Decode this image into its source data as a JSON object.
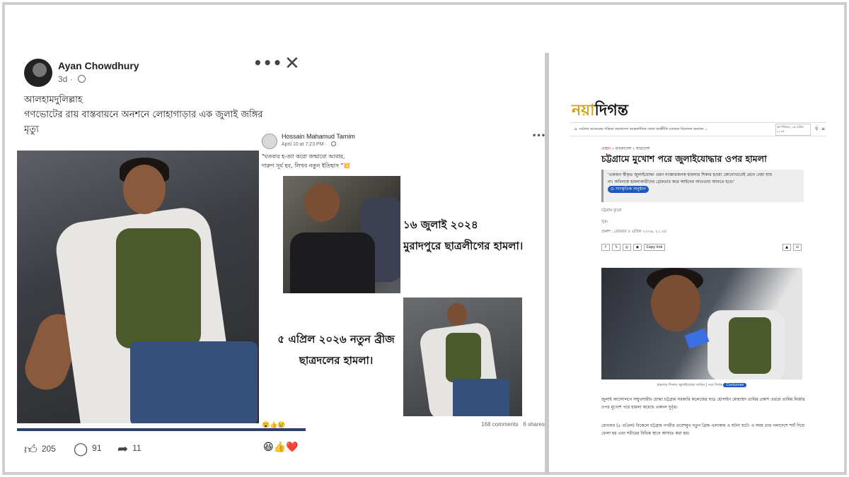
{
  "fb_post": {
    "author": "Ayan Chowdhury",
    "time": "3d",
    "text_line1": "আলহামদুলিল্লাহ",
    "text_line2": "গণভোটের রায় বাস্তবায়নে অনশনে লোহাগাড়ার এক জুলাই জঙ্গির",
    "text_line3": "মৃত্যু",
    "likes": "205",
    "comments": "91",
    "shares": "11"
  },
  "shared_post": {
    "author": "Hossain Mahamud Tamim",
    "time": "April 10 at 7:23 PM",
    "text_line1": "\"যতবার হ-ত্যা করো জন্মাবো আবার,",
    "text_line2": "দারুণ সূর্য হব, লিখব নতুন ইতিহাস \"💥",
    "caption1_line1": "১৬ জুলাই ২০২৪",
    "caption1_line2": "মুরাদপুরে ছাত্রলীগের হামলা।",
    "caption2_line1": "৫ এপ্রিল ২০২৬ নতুন ব্রীজ",
    "caption2_line2": "ছাত্রদলের হামলা।",
    "comments_count": "168 comments",
    "shares_count": "6 shares"
  },
  "newspaper": {
    "logo_part1": "নয়া",
    "logo_part2": "দিগন্ত",
    "nav_items": "সর্বশেষ  আজকের পত্রিকা  বাংলাদেশ  আন্তর্জাতিক  খেলা  অর্থনীতি  মতামত  বিনোদন  অন্যান্য",
    "date_box": "বৃহস্পতিবার, ১৬ এপ্রিল ২০২৬",
    "breadcrumb_home": "প্রচ্ছদ",
    "breadcrumb_section": "বাংলাদেশ",
    "breadcrumb_sub": "সারাদেশ",
    "headline": "চট্টগ্রামে মুখোশ পরে জুলাইযোদ্ধার ওপর হামলা",
    "quote_line1": "'একজন স্বীকৃত জুলাইযোদ্ধা এমন ন্যাক্কারজনক হামলার শিকার হওয়া কোনোভাবেই মেনে নেয়া যায়",
    "quote_line2": "না। অবিলম্বে হামলাকারীদের গ্রেফতার করে আইনের আওতায় আনতে হবে।'",
    "tag_label": "সাংস্কৃতিক অনুষ্ঠান",
    "reporter": "চট্টগ্রাম ব্যুরো",
    "source_label": "সূত্র:",
    "published": "প্রকাশ : রোববার ৫ এপ্রিল ২০২৬, ২১:২৮",
    "copy_link": "Copy link",
    "photo_caption": "হামলার শিকার জুলাইযোদ্ধা তামিম | নয়া দিগন্ত",
    "photo_tag": "Costumes",
    "para1": "জুলাই আন্দোলনে সম্মুখসারীর যোদ্ধা চট্টগ্রাম সরকারি কলেজের ছাত্র হোসাইন মোহাম্মদ তামিম প্রকাশ ওরফে তামিম মির্জার ওপর মুখোশ পরে হামলা করেছে একদল দুর্বৃত্ত।",
    "para2": "রোববার (৫ এপ্রিল) বিকেলে চট্টগ্রাম নগরীর প্রবেশমুখ নতুন ব্রিজ এলাকায় এ ঘটনা ঘটে। এ সময় তার গলাদেশে শার্ট দিয়ে ফেলা হয় এবং শরীরের বিভিন্ন স্থানে আঘাত করা হয়।"
  }
}
